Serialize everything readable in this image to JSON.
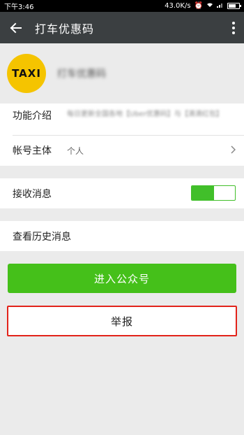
{
  "status_bar": {
    "time": "下午3:46",
    "speed": "43.0K/s",
    "battery_level": 0.7
  },
  "app_bar": {
    "title": "打车优惠码",
    "back_icon": "arrow-left-icon",
    "more_icon": "more-vertical-icon"
  },
  "profile": {
    "logo_text": "TAXI",
    "name": "打车优惠码"
  },
  "info": {
    "intro_label": "功能介绍",
    "intro_value": "每日更新全国各地【Uber优惠码】与【滴滴红包】",
    "owner_label": "帐号主体",
    "owner_value": "个人"
  },
  "settings": {
    "receive_label": "接收消息",
    "receive_on": true
  },
  "history": {
    "label": "查看历史消息"
  },
  "buttons": {
    "enter_label": "进入公众号",
    "report_label": "举报"
  },
  "colors": {
    "accent": "#45c01a",
    "appbar": "#3b3f41",
    "logo": "#f5c400",
    "report_border": "#e2231a"
  }
}
